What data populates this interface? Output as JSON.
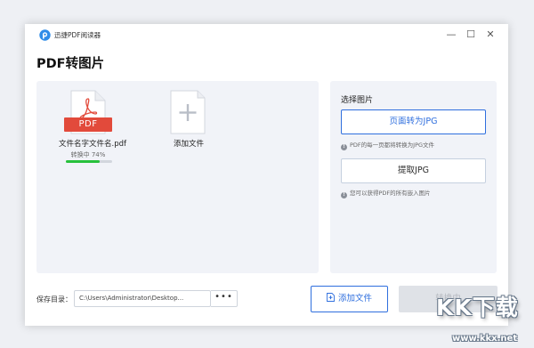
{
  "app": {
    "title": "迅捷PDF阅读器",
    "logo_icon": "app-logo-icon"
  },
  "window_controls": {
    "minimize": "—",
    "maximize": "☐",
    "close": "✕"
  },
  "page": {
    "title": "PDF转图片"
  },
  "files": [
    {
      "name": "文件名字文件名.pdf",
      "badge": "PDF",
      "status": "转换中 74%",
      "progress": 0.74
    }
  ],
  "add_tile": {
    "label": "添加文件"
  },
  "options": {
    "section_title": "选择图片",
    "items": [
      {
        "label": "页面转为JPG",
        "hint": "PDF的每一页都将转换为JPG文件",
        "selected": true
      },
      {
        "label": "提取JPG",
        "hint": "您可以获得PDF的所有嵌入图片",
        "selected": false
      }
    ]
  },
  "footer": {
    "save_label": "保存目录：",
    "path": "C:\\Users\\Administrator\\Desktop...",
    "browse_label": "•••",
    "add_file_label": "添加文件",
    "convert_label": "转换中"
  },
  "watermark": {
    "text": "KK下载",
    "url": "www.kkx.net"
  },
  "colors": {
    "accent": "#2f6fde",
    "pdf_red": "#e24a3b",
    "progress_green": "#28c13c",
    "panel_bg": "#f1f3f8"
  }
}
